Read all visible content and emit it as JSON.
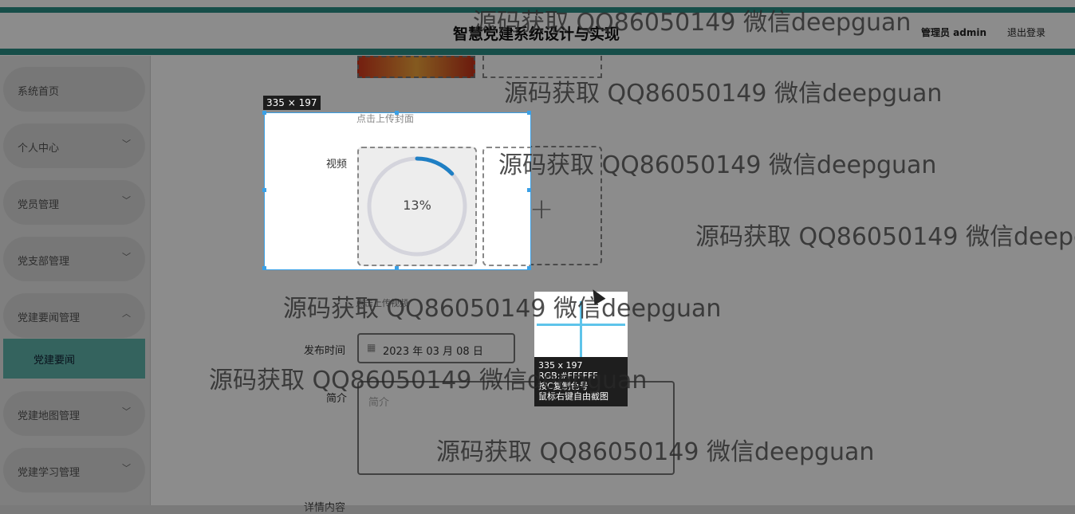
{
  "header": {
    "title": "智慧党建系统设计与实现",
    "admin_label": "管理员 admin",
    "logout_label": "退出登录"
  },
  "sidebar": {
    "items": [
      {
        "label": "系统首页"
      },
      {
        "label": "个人中心",
        "chevron": "﹀"
      },
      {
        "label": "党员管理",
        "chevron": "﹀"
      },
      {
        "label": "党支部管理",
        "chevron": "﹀"
      },
      {
        "label": "党建要闻管理",
        "chevron": "︿"
      },
      {
        "label": "党建地图管理",
        "chevron": "﹀"
      },
      {
        "label": "党建学习管理",
        "chevron": "﹀"
      }
    ],
    "sub_item": "党建要闻"
  },
  "form": {
    "cover_hint": "点击上传封面",
    "video_label": "视频",
    "video_hint": "点击上传视频",
    "upload_progress_text": "13%",
    "upload_progress": 0.13,
    "publish_label": "发布时间",
    "publish_value": "2023 年 03 月 08 日",
    "intro_label": "简介",
    "intro_placeholder": "简介",
    "detail_label": "详情内容"
  },
  "capture_tool": {
    "size_tag": "335 × 197",
    "mag_size": "335 x 197",
    "mag_rgb": "RGB:#FFFFFF",
    "mag_copy": "按C复制色号",
    "mag_free": "鼠标右键自由截图"
  },
  "watermark": "源码获取 QQ86050149 微信deepguan",
  "colors": {
    "accent": "#2a8f85",
    "selection": "#3aa0e6",
    "progress": "#1f7fc4"
  }
}
